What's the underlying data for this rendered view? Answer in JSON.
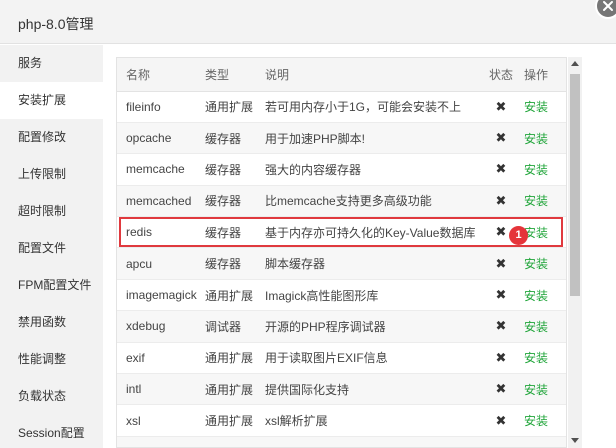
{
  "window": {
    "title": "php-8.0管理"
  },
  "sidebar": {
    "items": [
      {
        "label": "服务"
      },
      {
        "label": "安装扩展"
      },
      {
        "label": "配置修改"
      },
      {
        "label": "上传限制"
      },
      {
        "label": "超时限制"
      },
      {
        "label": "配置文件"
      },
      {
        "label": "FPM配置文件"
      },
      {
        "label": "禁用函数"
      },
      {
        "label": "性能调整"
      },
      {
        "label": "负载状态"
      },
      {
        "label": "Session配置"
      }
    ],
    "active_index": 1
  },
  "table": {
    "headers": {
      "name": "名称",
      "type": "类型",
      "desc": "说明",
      "status": "状态",
      "op": "操作"
    },
    "rows": [
      {
        "name": "fileinfo",
        "type": "通用扩展",
        "desc": "若可用内存小于1G，可能会安装不上",
        "status": "✖",
        "op": "安装"
      },
      {
        "name": "opcache",
        "type": "缓存器",
        "desc": "用于加速PHP脚本!",
        "status": "✖",
        "op": "安装"
      },
      {
        "name": "memcache",
        "type": "缓存器",
        "desc": "强大的内容缓存器",
        "status": "✖",
        "op": "安装"
      },
      {
        "name": "memcached",
        "type": "缓存器",
        "desc": "比memcache支持更多高级功能",
        "status": "✖",
        "op": "安装"
      },
      {
        "name": "redis",
        "type": "缓存器",
        "desc": "基于内存亦可持久化的Key-Value数据库",
        "status": "✖",
        "op": "安装"
      },
      {
        "name": "apcu",
        "type": "缓存器",
        "desc": "脚本缓存器",
        "status": "✖",
        "op": "安装"
      },
      {
        "name": "imagemagick",
        "type": "通用扩展",
        "desc": "Imagick高性能图形库",
        "status": "✖",
        "op": "安装"
      },
      {
        "name": "xdebug",
        "type": "调试器",
        "desc": "开源的PHP程序调试器",
        "status": "✖",
        "op": "安装"
      },
      {
        "name": "exif",
        "type": "通用扩展",
        "desc": "用于读取图片EXIF信息",
        "status": "✖",
        "op": "安装"
      },
      {
        "name": "intl",
        "type": "通用扩展",
        "desc": "提供国际化支持",
        "status": "✖",
        "op": "安装"
      },
      {
        "name": "xsl",
        "type": "通用扩展",
        "desc": "xsl解析扩展",
        "status": "✖",
        "op": "安装"
      },
      {
        "name": "",
        "type": "",
        "desc": "",
        "status": "",
        "op": ""
      }
    ]
  },
  "annotation": {
    "badge": "1",
    "highlighted_row": "redis"
  },
  "colors": {
    "install_link": "#20a53a",
    "highlight_border": "#e0393e",
    "badge_bg": "#e5343a"
  }
}
